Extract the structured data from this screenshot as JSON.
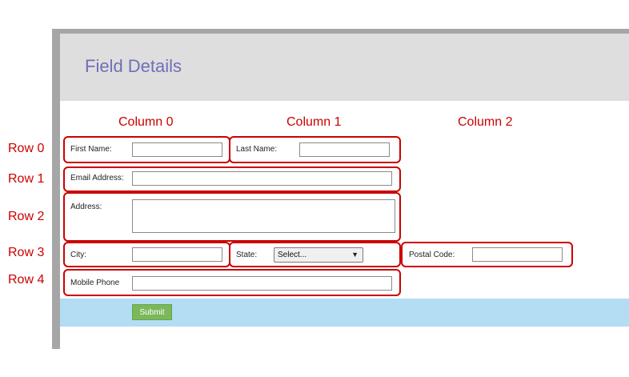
{
  "page": {
    "title": "Field Details"
  },
  "columns": [
    "Column 0",
    "Column 1",
    "Column 2"
  ],
  "rows": [
    "Row 0",
    "Row 1",
    "Row 2",
    "Row 3",
    "Row 4"
  ],
  "fields": {
    "first_name": {
      "label": "First Name:",
      "value": ""
    },
    "last_name": {
      "label": "Last Name:",
      "value": ""
    },
    "email": {
      "label": "Email Address:",
      "value": ""
    },
    "address": {
      "label": "Address:",
      "value": ""
    },
    "city": {
      "label": "City:",
      "value": ""
    },
    "state": {
      "label": "State:",
      "selected": "Select..."
    },
    "postal_code": {
      "label": "Postal Code:",
      "value": ""
    },
    "mobile_phone": {
      "label": "Mobile Phone",
      "value": ""
    }
  },
  "submit_label": "Submit",
  "colors": {
    "annotation": "#cc0000",
    "title": "#6f6fb8",
    "header_bg": "#dedede",
    "footer_bg": "#b3ddf3",
    "submit_bg": "#7ab85a"
  }
}
